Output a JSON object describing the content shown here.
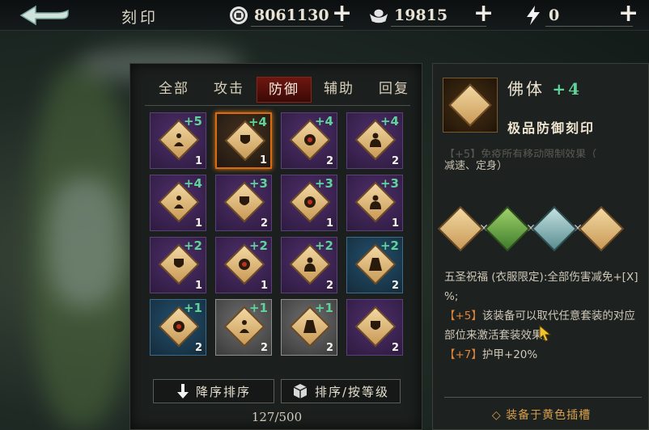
{
  "header": {
    "title": "刻印",
    "coins": "8061130",
    "silver": "19815",
    "energy": "0"
  },
  "tabs": [
    "全部",
    "攻击",
    "防御",
    "辅助",
    "回复"
  ],
  "active_tab": "防御",
  "grid": [
    [
      {
        "lvl": "+5",
        "cnt": "1",
        "rarity": "purple",
        "icon": "meditating-figure-icon"
      },
      {
        "lvl": "+4",
        "cnt": "1",
        "rarity": "selected",
        "icon": "shield-icon"
      },
      {
        "lvl": "+4",
        "cnt": "2",
        "rarity": "purple",
        "icon": "armor-icon"
      },
      {
        "lvl": "+4",
        "cnt": "2",
        "rarity": "purple",
        "icon": "torso-icon"
      }
    ],
    [
      {
        "lvl": "+4",
        "cnt": "1",
        "rarity": "purple",
        "icon": "meditating-figure-icon"
      },
      {
        "lvl": "+3",
        "cnt": "2",
        "rarity": "purple",
        "icon": "shield-icon"
      },
      {
        "lvl": "+3",
        "cnt": "1",
        "rarity": "purple",
        "icon": "armor-icon"
      },
      {
        "lvl": "+3",
        "cnt": "1",
        "rarity": "purple",
        "icon": "torso-icon"
      }
    ],
    [
      {
        "lvl": "+2",
        "cnt": "1",
        "rarity": "purple",
        "icon": "shield-icon"
      },
      {
        "lvl": "+2",
        "cnt": "1",
        "rarity": "purple",
        "icon": "armor-icon"
      },
      {
        "lvl": "+2",
        "cnt": "2",
        "rarity": "purple",
        "icon": "torso-icon"
      },
      {
        "lvl": "+2",
        "cnt": "2",
        "rarity": "blue",
        "icon": "cape-icon"
      }
    ],
    [
      {
        "lvl": "+1",
        "cnt": "2",
        "rarity": "blue",
        "icon": "armor-icon"
      },
      {
        "lvl": "+1",
        "cnt": "2",
        "rarity": "white",
        "icon": "meditating-figure-icon"
      },
      {
        "lvl": "+1",
        "cnt": "2",
        "rarity": "white",
        "icon": "cape-icon"
      },
      {
        "lvl": "",
        "cnt": "2",
        "rarity": "purple",
        "icon": "shield-icon"
      }
    ]
  ],
  "buttons": {
    "sort_desc": "降序排序",
    "sort_level": "排序/按等级"
  },
  "inventory_count": "127/500",
  "detail": {
    "name": "佛体",
    "plus": "+4",
    "grade": "极品防御刻印",
    "desc_partial_line": "【+5】免疫所有移动限制效果（",
    "desc_line2": "减速、定身）",
    "set_text": "五圣祝福 (衣服限定):全部伤害减免+[X] %;",
    "bonus5_tag": "【+5】",
    "bonus5_text": "该装备可以取代任意套装的对应部位来激活套装效果;",
    "bonus7_tag": "【+7】",
    "bonus7_text": "护甲+20%",
    "equip_hint": "◇ 装备于黄色插槽"
  },
  "colors": {
    "accent_green": "#5fd39b",
    "tab_active": "#6e1710",
    "highlight_orange": "#e0843a",
    "equip_gold": "#d8a04a"
  }
}
